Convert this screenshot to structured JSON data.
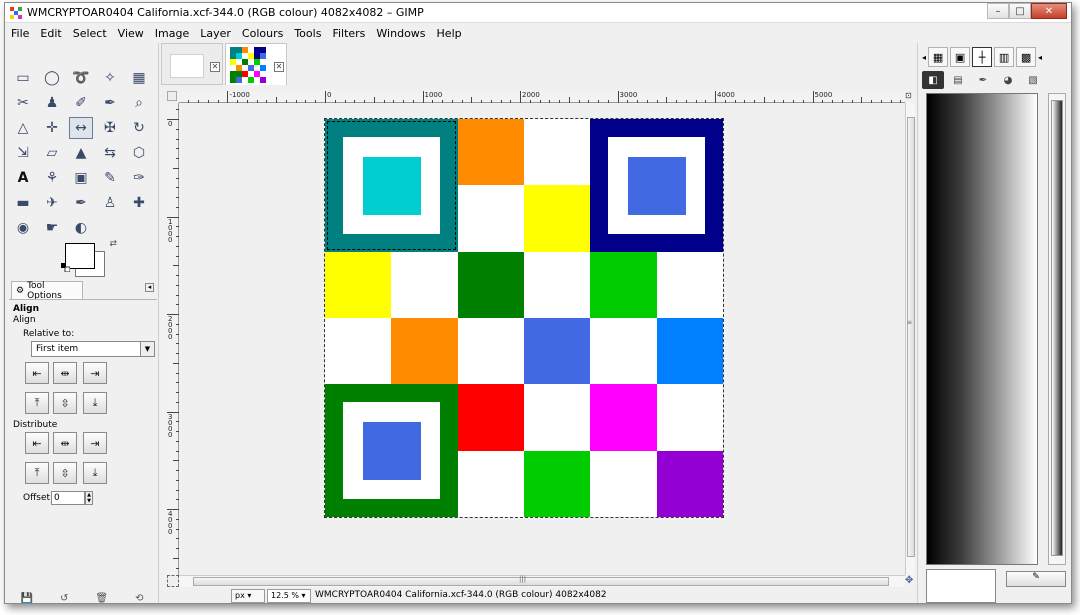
{
  "window": {
    "title": "WMCRYPTOAR0404 California.xcf-344.0 (RGB colour) 4082x4082 – GIMP",
    "controls": {
      "minimize": "–",
      "maximize": "□",
      "close": "✕"
    }
  },
  "menu": [
    "File",
    "Edit",
    "Select",
    "View",
    "Image",
    "Layer",
    "Colours",
    "Tools",
    "Filters",
    "Windows",
    "Help"
  ],
  "toolbox": {
    "tools": [
      {
        "name": "rect-select-icon",
        "glyph": "▭"
      },
      {
        "name": "ellipse-select-icon",
        "glyph": "◯"
      },
      {
        "name": "free-select-icon",
        "glyph": "➰"
      },
      {
        "name": "fuzzy-select-icon",
        "glyph": "✧"
      },
      {
        "name": "select-by-color-icon",
        "glyph": "▦"
      },
      {
        "name": "scissors-icon",
        "glyph": "✂"
      },
      {
        "name": "foreground-select-icon",
        "glyph": "♟"
      },
      {
        "name": "paths-icon",
        "glyph": "✐"
      },
      {
        "name": "color-picker-icon",
        "glyph": "✒"
      },
      {
        "name": "zoom-icon",
        "glyph": "⌕"
      },
      {
        "name": "measure-icon",
        "glyph": "△"
      },
      {
        "name": "move-icon",
        "glyph": "✛"
      },
      {
        "name": "align-icon",
        "glyph": "↔",
        "active": true
      },
      {
        "name": "crop-icon",
        "glyph": "✠"
      },
      {
        "name": "rotate-icon",
        "glyph": "↻"
      },
      {
        "name": "scale-icon",
        "glyph": "⇲"
      },
      {
        "name": "shear-icon",
        "glyph": "▱"
      },
      {
        "name": "perspective-icon",
        "glyph": "▲"
      },
      {
        "name": "flip-icon",
        "glyph": "⇆"
      },
      {
        "name": "cage-icon",
        "glyph": "⬡"
      },
      {
        "name": "text-icon",
        "glyph": "A"
      },
      {
        "name": "bucket-fill-icon",
        "glyph": "⚘"
      },
      {
        "name": "blend-icon",
        "glyph": "▣"
      },
      {
        "name": "pencil-icon",
        "glyph": "✎"
      },
      {
        "name": "paintbrush-icon",
        "glyph": "✑"
      },
      {
        "name": "eraser-icon",
        "glyph": "▬"
      },
      {
        "name": "airbrush-icon",
        "glyph": "✈"
      },
      {
        "name": "ink-icon",
        "glyph": "✒"
      },
      {
        "name": "clone-icon",
        "glyph": "♙"
      },
      {
        "name": "heal-icon",
        "glyph": "✚"
      },
      {
        "name": "blur-icon",
        "glyph": "◉"
      },
      {
        "name": "smudge-icon",
        "glyph": "☛"
      },
      {
        "name": "dodge-burn-icon",
        "glyph": "◐"
      }
    ],
    "tool_options_tab": "Tool Options",
    "align_title": "Align",
    "align_subtitle": "Align",
    "relative_to_label": "Relative to:",
    "relative_to_value": "First item",
    "distribute_label": "Distribute",
    "offset_label": "Offset:",
    "offset_value": "0"
  },
  "image_window": {
    "ruler_labels": [
      "-1000",
      "0",
      "1000",
      "2000",
      "3000",
      "4000",
      "5000"
    ],
    "vruler_labels": [
      "0",
      "1000",
      "2000",
      "3000",
      "4000"
    ],
    "units": "px",
    "zoom": "12.5 %",
    "status": "WMCRYPTOAR0404 California.xcf-344.0 (RGB colour) 4082x4082"
  },
  "colors": {
    "teal": "#008080",
    "cyan": "#00ced1",
    "orange": "#ff8c00",
    "navy": "#00008b",
    "royalblue": "#4169e1",
    "yellow": "#ffff00",
    "green": "#008000",
    "lime": "#00cc00",
    "azure": "#0080ff",
    "red": "#ff0000",
    "magenta": "#ff00ff",
    "purple": "#9400d3",
    "white": "#ffffff"
  }
}
